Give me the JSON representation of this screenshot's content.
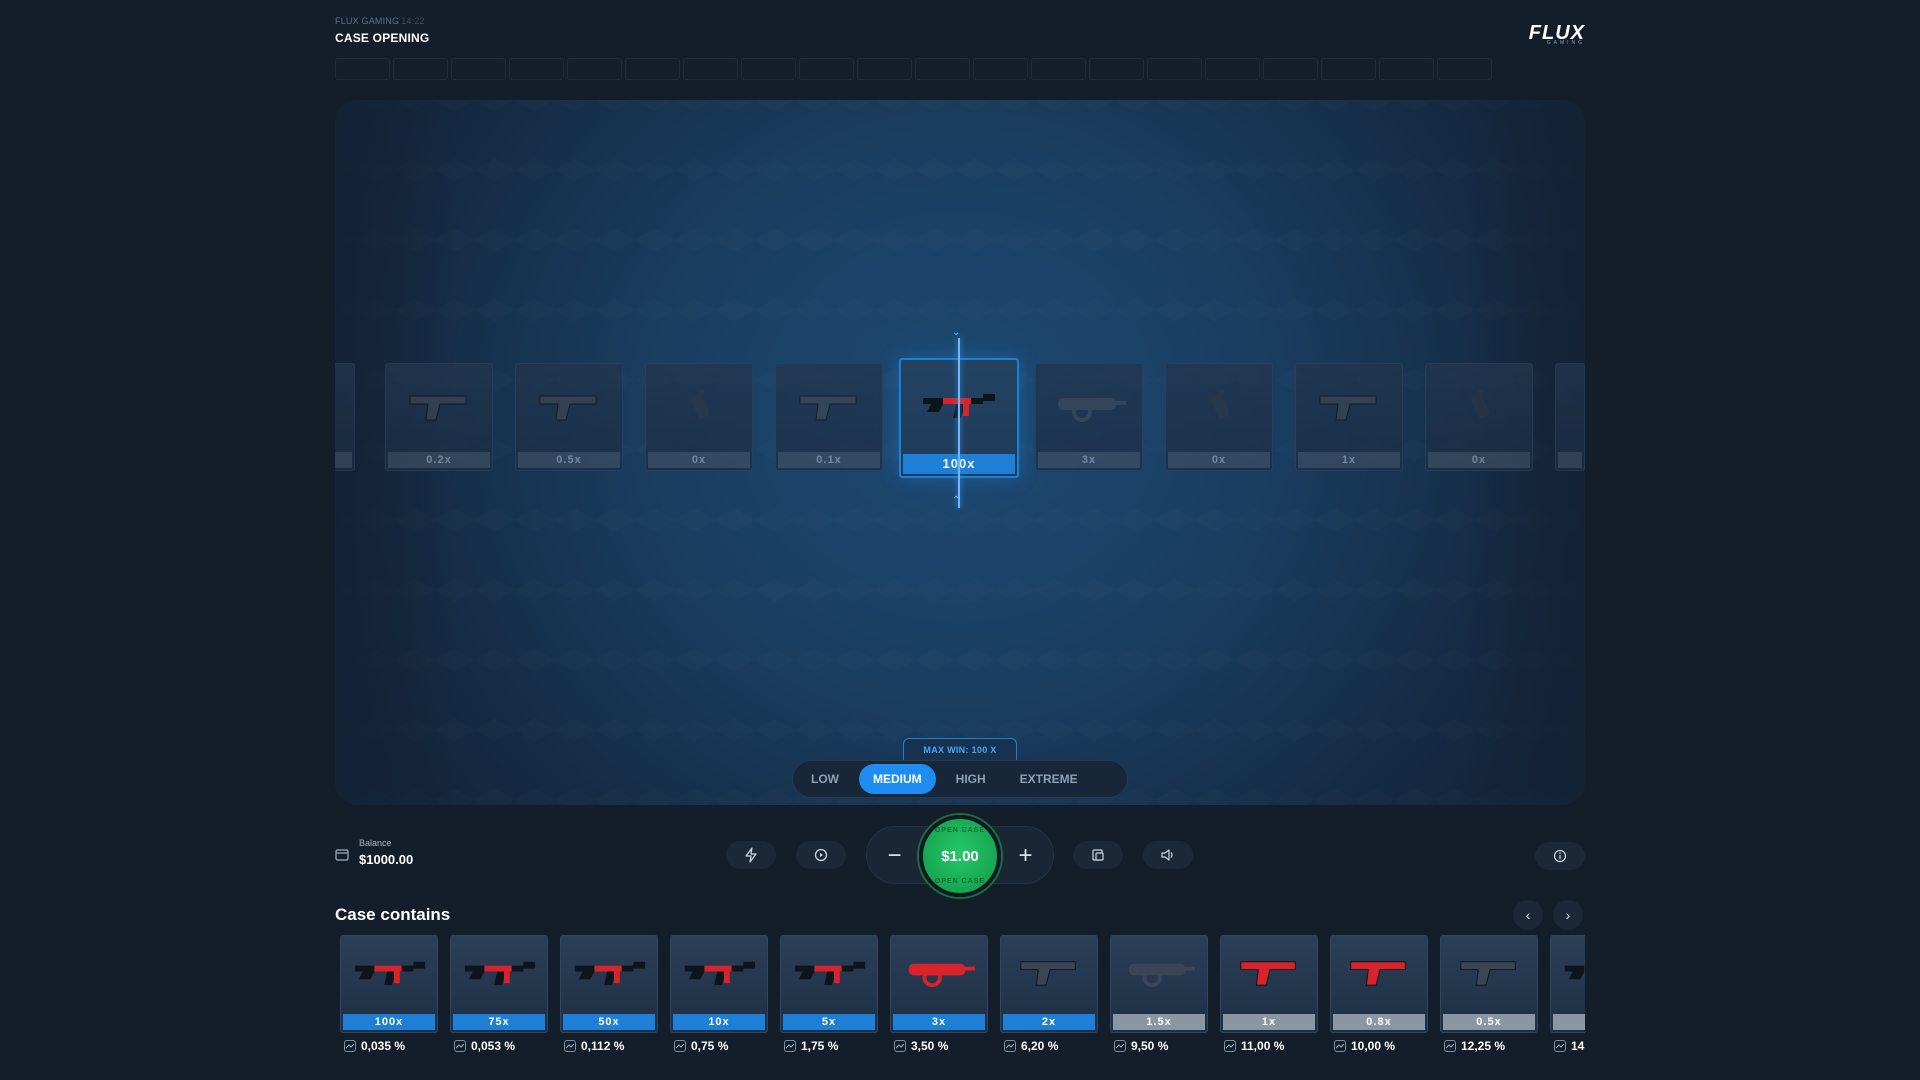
{
  "header": {
    "brand": "FLUX GAMING",
    "time": "14:22",
    "title": "CASE OPENING",
    "logo_main": "FLUX",
    "logo_sub": "GAMING"
  },
  "history_count": 20,
  "reel": {
    "cards": [
      {
        "mult": "",
        "edge": true
      },
      {
        "mult": "0.2x",
        "gun": "pistol-icon"
      },
      {
        "mult": "0.5x",
        "gun": "pistol-icon"
      },
      {
        "mult": "0x",
        "gun": "grenade-icon"
      },
      {
        "mult": "0.1x",
        "gun": "pistol-icon"
      },
      {
        "mult": "100x",
        "gun": "rifle-icon",
        "win": true
      },
      {
        "mult": "3x",
        "gun": "smg-icon"
      },
      {
        "mult": "0x",
        "gun": "grenade-icon"
      },
      {
        "mult": "1x",
        "gun": "pistol-icon"
      },
      {
        "mult": "0x",
        "gun": "grenade-icon"
      },
      {
        "mult": "",
        "edge": true
      }
    ]
  },
  "max_win": "MAX WIN: 100 X",
  "risk": {
    "options": [
      "LOW",
      "MEDIUM",
      "HIGH",
      "EXTREME"
    ],
    "selected": "MEDIUM"
  },
  "balance": {
    "label": "Balance",
    "value": "$1000.00"
  },
  "bet": {
    "value": "$1.00",
    "minus": "−",
    "plus": "+",
    "open_label": "OPEN CASE"
  },
  "case": {
    "title": "Case contains",
    "prev": "‹",
    "next": "›",
    "items": [
      {
        "mult": "100x",
        "odds": "0,035 %",
        "tier": "blue"
      },
      {
        "mult": "75x",
        "odds": "0,053 %",
        "tier": "blue"
      },
      {
        "mult": "50x",
        "odds": "0,112 %",
        "tier": "blue"
      },
      {
        "mult": "10x",
        "odds": "0,75 %",
        "tier": "blue"
      },
      {
        "mult": "5x",
        "odds": "1,75 %",
        "tier": "blue"
      },
      {
        "mult": "3x",
        "odds": "3,50 %",
        "tier": "blue"
      },
      {
        "mult": "2x",
        "odds": "6,20 %",
        "tier": "blue"
      },
      {
        "mult": "1.5x",
        "odds": "9,50 %",
        "tier": "grey"
      },
      {
        "mult": "1x",
        "odds": "11,00 %",
        "tier": "grey"
      },
      {
        "mult": "0.8x",
        "odds": "10,00 %",
        "tier": "grey"
      },
      {
        "mult": "0.5x",
        "odds": "12,25 %",
        "tier": "grey"
      },
      {
        "mult": "",
        "odds": "14",
        "tier": "grey"
      }
    ]
  },
  "colors": {
    "accent": "#1e8cf0",
    "open_button": "#17a652",
    "background": "#141d2a"
  }
}
